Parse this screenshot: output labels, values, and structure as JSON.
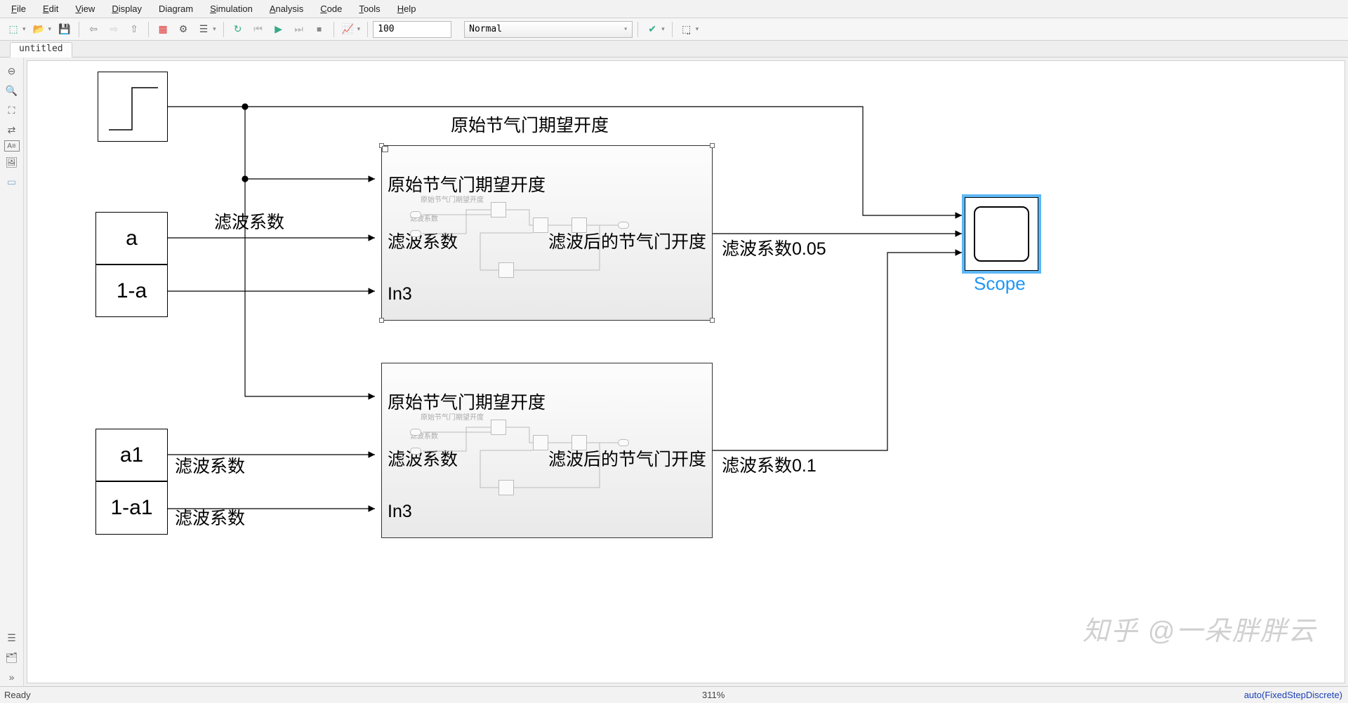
{
  "menu": {
    "file": "File",
    "edit": "Edit",
    "view": "View",
    "display": "Display",
    "diagram": "Diagram",
    "simulation": "Simulation",
    "analysis": "Analysis",
    "code": "Code",
    "tools": "Tools",
    "help": "Help"
  },
  "toolbar": {
    "simtime": "100",
    "simmode": "Normal"
  },
  "tab": {
    "name": "untitled"
  },
  "blocks": {
    "step": {
      "type": "step"
    },
    "const": {
      "a": "a",
      "oma": "1-a",
      "a1": "a1",
      "oma1": "1-a1"
    },
    "subsystem1": {
      "in1": "原始节气门期望开度",
      "in2": "滤波系数",
      "in3": "In3",
      "out1": "滤波后的节气门开度",
      "mini_in1": "原始节气门期望开度",
      "mini_in2": "滤波系数"
    },
    "subsystem2": {
      "in1": "原始节气门期望开度",
      "in2": "滤波系数",
      "in3": "In3",
      "out1": "滤波后的节气门开度",
      "mini_in1": "原始节气门期望开度",
      "mini_in2": "滤波系数"
    },
    "scope": {
      "label": "Scope"
    }
  },
  "wires": {
    "top_signal": "原始节气门期望开度",
    "filter_coef": "滤波系数",
    "filter_coef2": "滤波系数",
    "filter_coef3": "滤波系数",
    "out1": "滤波系数0.05",
    "out2": "滤波系数0.1"
  },
  "status": {
    "ready": "Ready",
    "zoom": "311%",
    "solver": "auto(FixedStepDiscrete)"
  },
  "watermark": "知乎 @一朵胖胖云"
}
